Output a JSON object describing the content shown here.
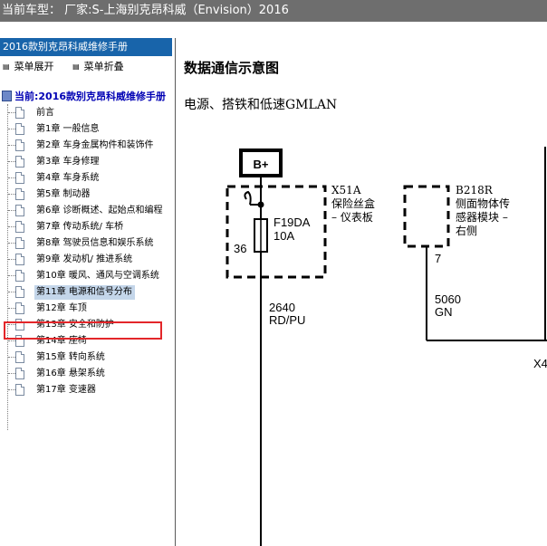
{
  "titlebar": {
    "text": "当前车型：  厂家:S-上海别克昂科威（Envision）2016"
  },
  "left_panel": {
    "manual_title": "2016款别克昂科威维修手册",
    "expand_label": "菜单展开",
    "collapse_label": "菜单折叠",
    "root_label": "当前:2016款别克昂科威维修手册",
    "chapters": [
      "前言",
      "第1章 一般信息",
      "第2章 车身金属构件和装饰件",
      "第3章 车身修理",
      "第4章 车身系统",
      "第5章 制动器",
      "第6章 诊断概述、起始点和编程",
      "第7章 传动系统/ 车桥",
      "第8章 驾驶员信息和娱乐系统",
      "第9章 发动机/ 推进系统",
      "第10章 暖风、通风与空调系统",
      "第11章 电源和信号分布",
      "第12章 车顶",
      "第13章 安全和防护",
      "第14章 座椅",
      "第15章 转向系统",
      "第16章 悬架系统",
      "第17章 变速器"
    ],
    "selected_index": 11
  },
  "content": {
    "title": "数据通信示意图",
    "subtitle": "电源、搭铁和低速GMLAN",
    "diagram": {
      "power_label": "B+",
      "fuse_box_ref": "X51A",
      "fuse_box_name_1": "保险丝盒",
      "fuse_box_name_2": "– 仪表板",
      "fuse_id": "F19DA",
      "fuse_rating": "10A",
      "fuse_pin": "36",
      "wire1_circuit": "2640",
      "wire1_color": "RD/PU",
      "module_ref": "B218R",
      "module_name_1": "侧面物体传",
      "module_name_2": "感器模块 –",
      "module_name_3": "右侧",
      "module_pin": "7",
      "wire2_circuit": "5060",
      "wire2_color": "GN",
      "cut_label": "X4"
    }
  }
}
